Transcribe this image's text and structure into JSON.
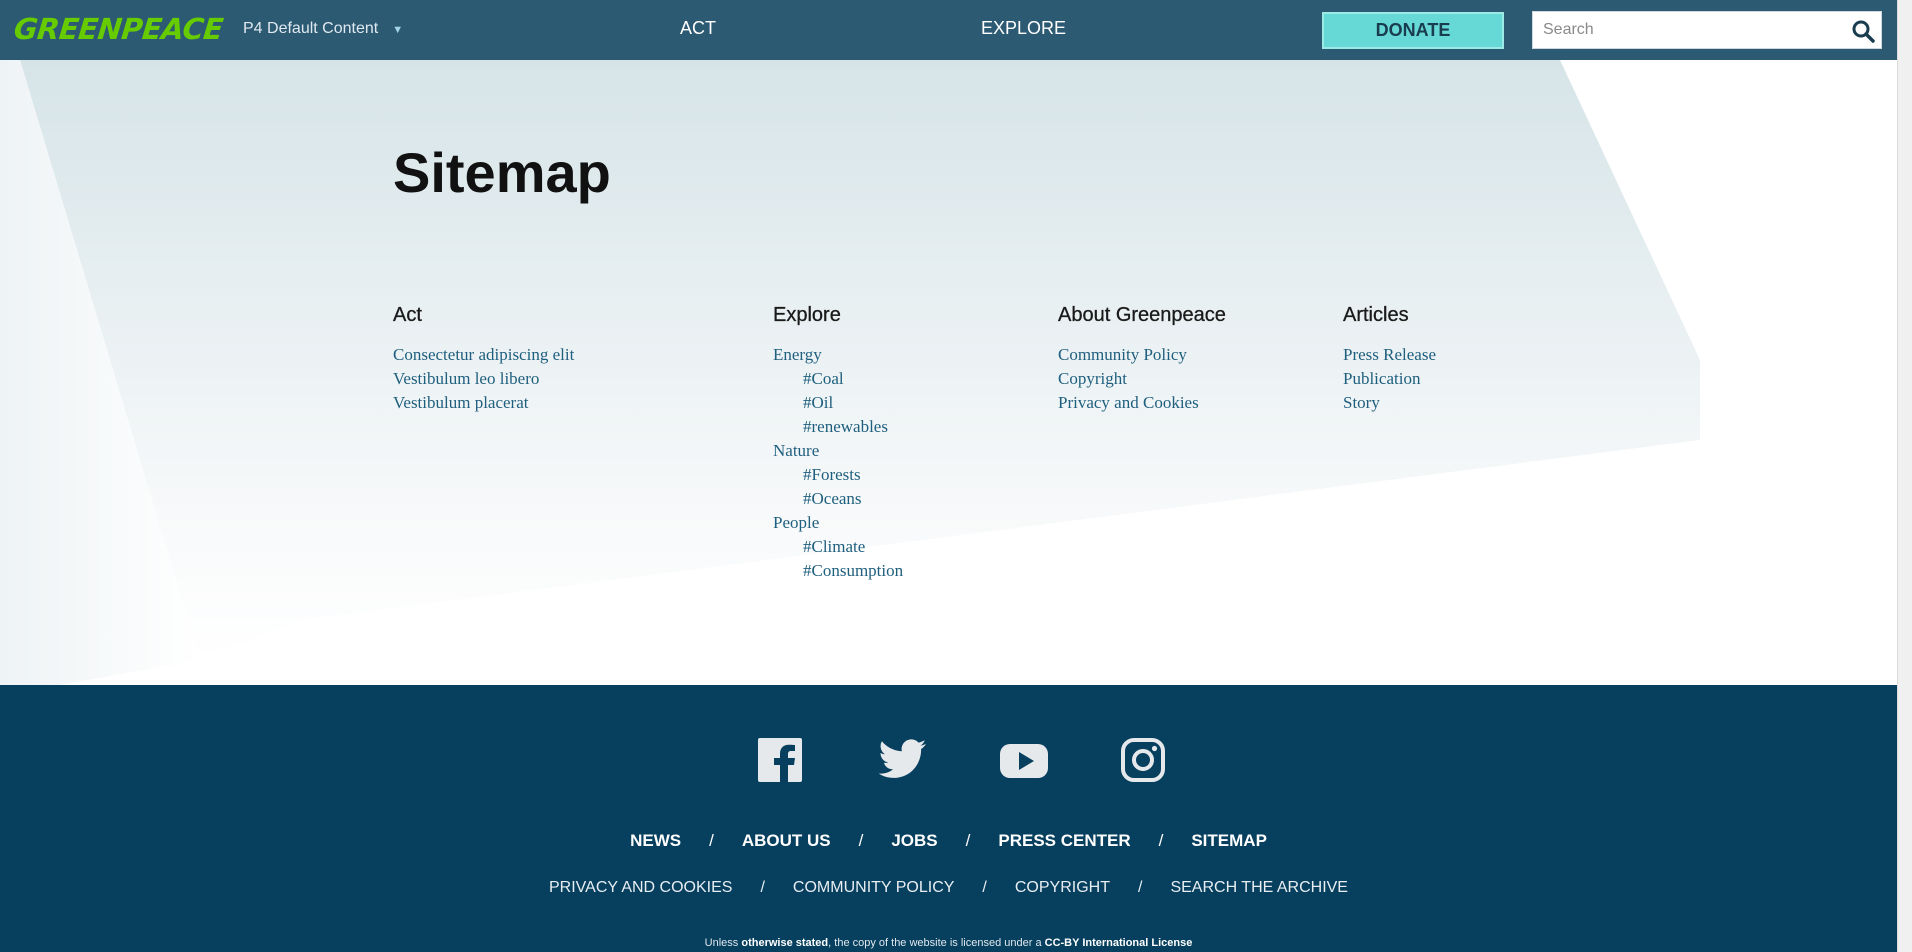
{
  "header": {
    "logo_text": "GREENPEACE",
    "site_selector": "P4 Default Content",
    "nav": {
      "act": "ACT",
      "explore": "EXPLORE"
    },
    "donate_label": "DONATE",
    "search_placeholder": "Search"
  },
  "page": {
    "title": "Sitemap"
  },
  "sitemap": {
    "act": {
      "heading": "Act",
      "items": [
        "Consectetur adipiscing elit",
        "Vestibulum leo libero",
        "Vestibulum placerat"
      ]
    },
    "explore": {
      "heading": "Explore",
      "items": [
        "Energy",
        "#Coal",
        "#Oil",
        "#renewables",
        "Nature",
        "#Forests",
        "#Oceans",
        "People",
        "#Climate",
        "#Consumption"
      ]
    },
    "about": {
      "heading": "About Greenpeace",
      "items": [
        "Community Policy",
        "Copyright",
        "Privacy and Cookies"
      ]
    },
    "articles": {
      "heading": "Articles",
      "items": [
        "Press Release",
        "Publication",
        "Story"
      ]
    }
  },
  "footer": {
    "social_icons": [
      "facebook-icon",
      "twitter-icon",
      "youtube-icon",
      "instagram-icon"
    ],
    "main_links": [
      "NEWS",
      "ABOUT US",
      "JOBS",
      "PRESS CENTER",
      "SITEMAP"
    ],
    "sub_links": [
      "PRIVACY AND COOKIES",
      "COMMUNITY POLICY",
      "COPYRIGHT",
      "SEARCH THE ARCHIVE"
    ],
    "separator": "/",
    "license": {
      "prefix": "Unless",
      "stated": "otherwise stated",
      "middle": ", the copy of the website is licensed under a",
      "license_name": "CC-BY International License"
    }
  },
  "colors": {
    "header_bg": "#2d5a73",
    "donate_bg": "#66d9d6",
    "link": "#1f5f7e",
    "footer_bg": "#073f5e",
    "logo": "#66cc00"
  }
}
